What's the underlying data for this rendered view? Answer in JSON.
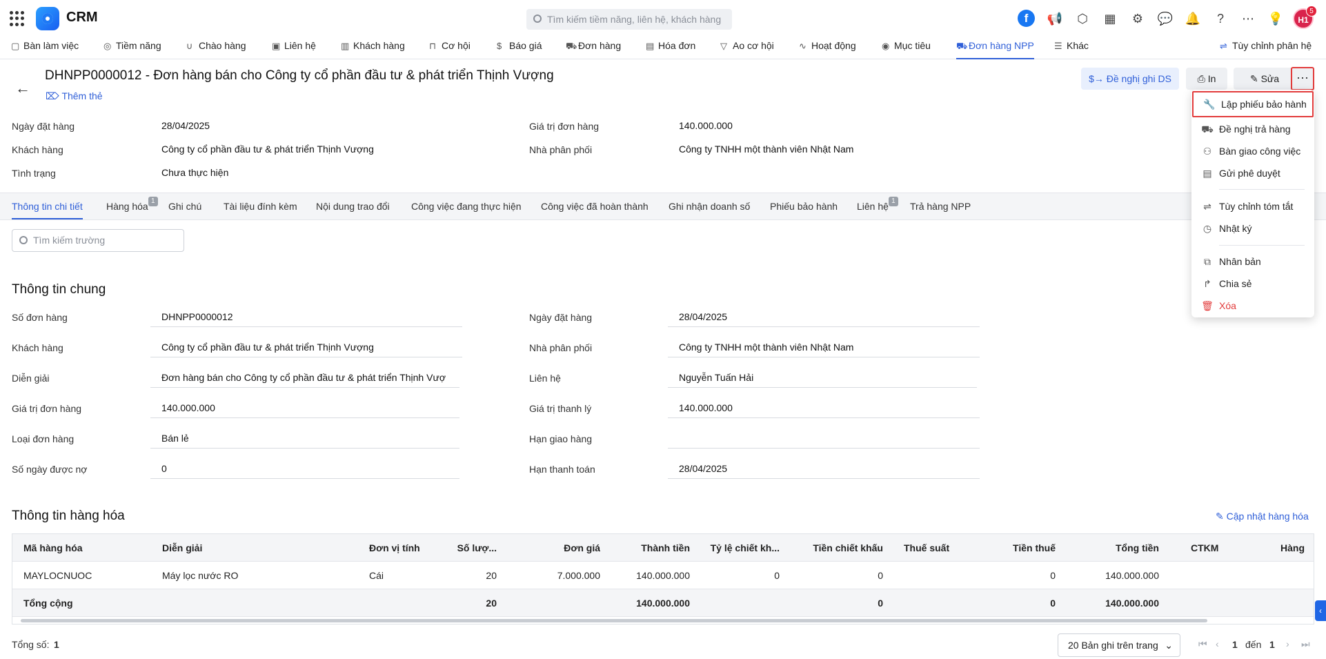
{
  "app": {
    "brand": "CRM",
    "search_placeholder": "Tìm kiếm tiềm năng, liên hệ, khách hàng",
    "avatar_initials": "H1",
    "notification_count": "5",
    "facebook_letter": "f"
  },
  "nav": {
    "items": [
      {
        "label": "Bàn làm việc",
        "icon": "briefcase-icon"
      },
      {
        "label": "Tiềm năng",
        "icon": "user-circle-icon"
      },
      {
        "label": "Chào hàng",
        "icon": "magnet-icon"
      },
      {
        "label": "Liên hệ",
        "icon": "contact-icon"
      },
      {
        "label": "Khách hàng",
        "icon": "building-icon"
      },
      {
        "label": "Cơ hội",
        "icon": "bag-icon"
      },
      {
        "label": "Báo giá",
        "icon": "quote-icon"
      },
      {
        "label": "Đơn hàng",
        "icon": "cart-icon"
      },
      {
        "label": "Hóa đơn",
        "icon": "invoice-icon"
      },
      {
        "label": "Ao cơ hội",
        "icon": "funnel-icon"
      },
      {
        "label": "Hoạt động",
        "icon": "activity-icon"
      },
      {
        "label": "Mục tiêu",
        "icon": "target-icon"
      },
      {
        "label": "Đơn hàng NPP",
        "icon": "cart-npp-icon"
      },
      {
        "label": "Khác",
        "icon": "menu-icon"
      }
    ],
    "customize": "Tùy chỉnh phân hệ"
  },
  "record": {
    "title": "DHNPP0000012 - Đơn hàng bán cho Công ty cổ phần đầu tư & phát triển Thịnh Vượng",
    "add_tag": "Thêm thẻ",
    "buttons": {
      "propose": "Đề nghị ghi DS",
      "print": "In",
      "edit": "Sửa",
      "more": "···"
    }
  },
  "summary": {
    "order_date_label": "Ngày đặt hàng",
    "order_date": "28/04/2025",
    "customer_label": "Khách hàng",
    "customer": "Công ty cổ phần đầu tư & phát triển Thịnh Vượng",
    "status_label": "Tình trạng",
    "status": "Chưa thực hiện",
    "order_value_label": "Giá trị đơn hàng",
    "order_value": "140.000.000",
    "distributor_label": "Nhà phân phối",
    "distributor": "Công ty TNHH một thành viên Nhật Nam"
  },
  "tabs": [
    {
      "label": "Thông tin chi tiết",
      "count": ""
    },
    {
      "label": "Hàng hóa",
      "count": "1"
    },
    {
      "label": "Ghi chú",
      "count": ""
    },
    {
      "label": "Tài liệu đính kèm",
      "count": ""
    },
    {
      "label": "Nội dung trao đổi",
      "count": ""
    },
    {
      "label": "Công việc đang thực hiện",
      "count": ""
    },
    {
      "label": "Công việc đã hoàn thành",
      "count": ""
    },
    {
      "label": "Ghi nhận doanh số",
      "count": ""
    },
    {
      "label": "Phiếu bảo hành",
      "count": ""
    },
    {
      "label": "Liên hệ",
      "count": "1"
    },
    {
      "label": "Trả hàng NPP",
      "count": ""
    }
  ],
  "field_search_placeholder": "Tìm kiếm trường",
  "general": {
    "title": "Thông tin chung",
    "left": [
      {
        "label": "Số đơn hàng",
        "value": "DHNPP0000012",
        "link": false
      },
      {
        "label": "Khách hàng",
        "value": "Công ty cổ phần đầu tư & phát triển Thịnh Vượng",
        "link": true
      },
      {
        "label": "Diễn giải",
        "value": "Đơn hàng bán cho Công ty cổ phần đầu tư & phát triển Thịnh Vượ",
        "link": false
      },
      {
        "label": "Giá trị đơn hàng",
        "value": "140.000.000",
        "link": false
      },
      {
        "label": "Loại đơn hàng",
        "value": "Bán lẻ",
        "link": false
      },
      {
        "label": "Số ngày được nợ",
        "value": "0",
        "link": false
      }
    ],
    "right": [
      {
        "label": "Ngày đặt hàng",
        "value": "28/04/2025",
        "link": false
      },
      {
        "label": "Nhà phân phối",
        "value": "Công ty TNHH một thành viên Nhật Nam",
        "link": true
      },
      {
        "label": "Liên hệ",
        "value": "Nguyễn Tuấn Hải",
        "link": true
      },
      {
        "label": "Giá trị thanh lý",
        "value": "140.000.000",
        "link": false
      },
      {
        "label": "Hạn giao hàng",
        "value": "",
        "link": false
      },
      {
        "label": "Hạn thanh toán",
        "value": "28/04/2025",
        "link": false
      }
    ]
  },
  "goods": {
    "title": "Thông tin hàng hóa",
    "update_link": "Cập nhật hàng hóa",
    "columns": [
      "Mã hàng hóa",
      "Diễn giải",
      "Đơn vị tính",
      "Số lượ...",
      "Đơn giá",
      "Thành tiền",
      "Tỷ lệ chiết kh...",
      "Tiền chiết khấu",
      "Thuế suất",
      "Tiền thuế",
      "Tổng tiền",
      "CTKM",
      "Hàng"
    ],
    "rows": [
      [
        "MAYLOCNUOC",
        "Máy lọc nước RO",
        "Cái",
        "20",
        "7.000.000",
        "140.000.000",
        "0",
        "0",
        "",
        "0",
        "140.000.000",
        "",
        ""
      ]
    ],
    "total": [
      "Tổng cộng",
      "",
      "",
      "20",
      "",
      "140.000.000",
      "",
      "0",
      "",
      "0",
      "140.000.000",
      "",
      ""
    ]
  },
  "footer": {
    "total_label": "Tổng số:",
    "total": "1",
    "page_size": "20 Bản ghi trên trang",
    "page_from": "1",
    "page_to_label": "đến",
    "page_to": "1"
  },
  "more_menu": {
    "items": [
      {
        "label": "Lập phiếu bảo hành",
        "icon": "wrench-icon"
      },
      {
        "label": "Đề nghị trả hàng",
        "icon": "return-cart-icon"
      },
      {
        "label": "Bàn giao công việc",
        "icon": "handover-icon"
      },
      {
        "label": "Gửi phê duyệt",
        "icon": "approval-icon"
      },
      {
        "label": "Tùy chỉnh tóm tắt",
        "icon": "sliders-icon"
      },
      {
        "label": "Nhật ký",
        "icon": "history-icon"
      },
      {
        "label": "Nhân bản",
        "icon": "duplicate-icon"
      },
      {
        "label": "Chia sẻ",
        "icon": "share-icon"
      },
      {
        "label": "Xóa",
        "icon": "trash-icon"
      }
    ]
  }
}
